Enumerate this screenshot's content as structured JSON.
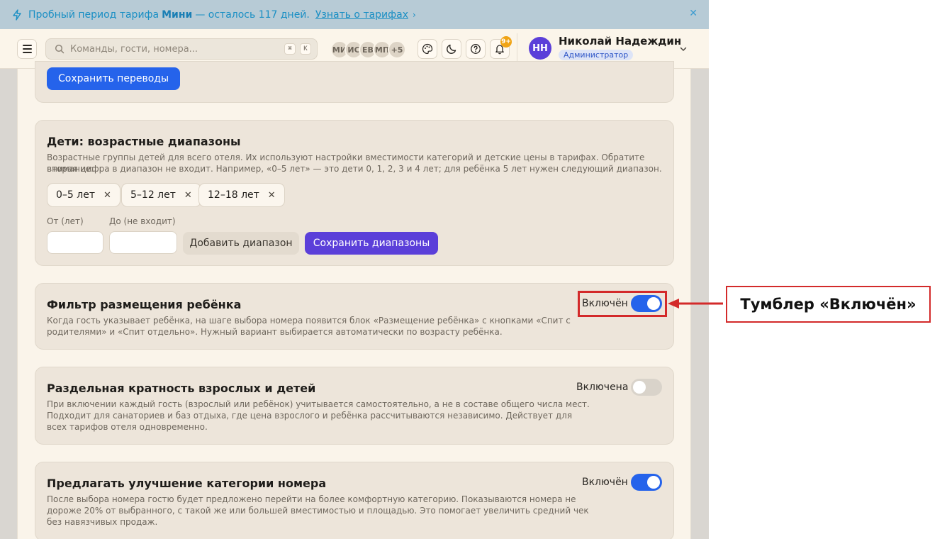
{
  "banner": {
    "text_prefix": "Пробный период тарифа",
    "plan": "Мини",
    "text_suffix": "— осталось 117 дней.",
    "link": "Узнать о тарифах",
    "chevron": "›",
    "close": "✕"
  },
  "topbar": {
    "search_placeholder": "Команды, гости, номера...",
    "shortcut_mod": "⌘",
    "shortcut_key": "K",
    "avatars": [
      "МИ",
      "ИС",
      "ЕВ",
      "МП",
      "+5"
    ],
    "notif_count": "9+",
    "user": {
      "initials": "НН",
      "name": "Николай Надеждин",
      "role": "Администратор"
    }
  },
  "translations": {
    "save_button": "Сохранить переводы"
  },
  "children_ranges": {
    "title": "Дети: возрастные диапазоны",
    "description_line1": "Возрастные группы детей для всего отеля. Их используют настройки вместимости категорий и детские цены в тарифах. Обратите внимание:",
    "description_line2": "вторая цифра в диапазон не входит. Например, «0–5 лет» — это дети 0, 1, 2, 3 и 4 лет; для ребёнка 5 лет нужен следующий диапазон.",
    "chips": [
      "0–5 лет",
      "5–12 лет",
      "12–18 лет"
    ],
    "chip_remove": "✕",
    "from_label": "От (лет)",
    "to_label": "До (не входит)",
    "from_value": "",
    "to_value": "",
    "add_button": "Добавить диапазон",
    "save_button": "Сохранить диапазоны"
  },
  "child_filter": {
    "title": "Фильтр размещения ребёнка",
    "description_line1": "Когда гость указывает ребёнка, на шаге выбора номера появится блок «Размещение ребёнка» с кнопками «Спит с",
    "description_line2": "родителями» и «Спит отдельно». Нужный вариант выбирается автоматически по возрасту ребёнка.",
    "toggle_label": "Включён",
    "enabled": true
  },
  "separate_multiplicity": {
    "title": "Раздельная кратность взрослых и детей",
    "description_line1": "При включении каждый гость (взрослый или ребёнок) учитывается самостоятельно, а не в составе общего числа мест.",
    "description_line2": "Подходит для санаториев и баз отдыха, где цена взрослого и ребёнка рассчитываются независимо. Действует для",
    "description_line3": "всех тарифов отеля одновременно.",
    "toggle_label": "Включена",
    "enabled": false
  },
  "upgrade_offer": {
    "title": "Предлагать улучшение категории номера",
    "description_line1": "После выбора номера гостю будет предложено перейти на более комфортную категорию. Показываются номера не",
    "description_line2": "дороже 20% от выбранного, с такой же или большей вместимостью и площадью. Это помогает увеличить средний чек",
    "description_line3": "без навязчивых продаж.",
    "toggle_label": "Включён",
    "enabled": true
  },
  "annotation": {
    "label": "Тумблер «Включён»"
  },
  "colors": {
    "accent_blue": "#2563eb",
    "accent_violet": "#5b3fd9",
    "annotation_red": "#d32a2a"
  }
}
